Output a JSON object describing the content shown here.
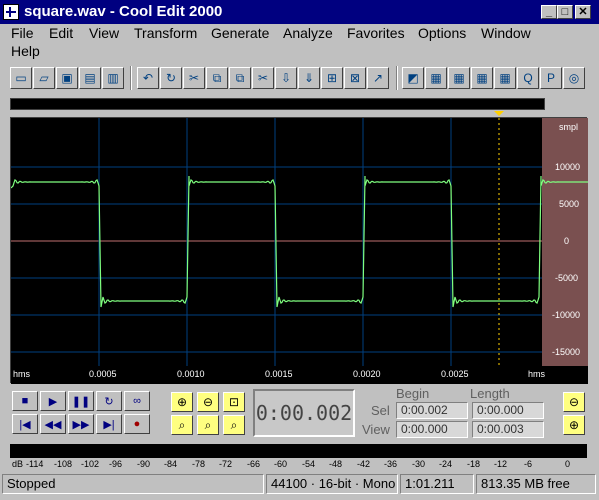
{
  "window": {
    "title": "square.wav - Cool Edit 2000",
    "minimize": "_",
    "maximize": "□",
    "close": "✕"
  },
  "menu": {
    "items": [
      "File",
      "Edit",
      "View",
      "Transform",
      "Generate",
      "Analyze",
      "Favorites",
      "Options",
      "Window",
      "Help"
    ]
  },
  "toolbar": {
    "icons": [
      "new-file-icon",
      "open-file-icon",
      "save-icon",
      "save-all-icon",
      "close-file-icon",
      "undo-icon",
      "repeat-icon",
      "mix-paste-icon",
      "copy-icon",
      "copy-to-new-icon",
      "cut-icon",
      "paste-icon",
      "paste-to-new-icon",
      "trim-icon",
      "mix-icon",
      "spectral-view-icon",
      "frequency-analysis-icon",
      "grid-icon",
      "grid-2-icon",
      "grid-3-icon",
      "cue-list-icon",
      "play-list-icon",
      "cd-icon"
    ]
  },
  "waveform": {
    "amplitude_unit": "smpl",
    "amplitude_ticks": [
      "10000",
      "5000",
      "0",
      "-5000",
      "-10000",
      "-15000"
    ],
    "time_unit_left": "hms",
    "time_unit_right": "hms",
    "time_ticks": [
      "0.0005",
      "0.0010",
      "0.0015",
      "0.0020",
      "0.0025"
    ],
    "wave_color": "#7fff7f",
    "grid_color": "#004080",
    "center_line_color": "#c07070",
    "ruler_color": "#7a5050"
  },
  "transport": {
    "stop": "■",
    "play": "▶",
    "pause": "❚❚",
    "play_looped": "↻",
    "loop": "∞",
    "goto_begin": "|◀",
    "rewind": "◀◀",
    "fast_forward": "▶▶",
    "goto_end": "▶|",
    "record": "●"
  },
  "time_display": "0:00.002",
  "selection": {
    "begin_label": "Begin",
    "length_label": "Length",
    "sel_label": "Sel",
    "view_label": "View",
    "sel_begin": "0:00.002",
    "sel_length": "0:00.000",
    "view_begin": "0:00.000",
    "view_length": "0:00.003"
  },
  "level_meter": {
    "unit": "dB",
    "ticks": [
      "-114",
      "-108",
      "-102",
      "-96",
      "-90",
      "-84",
      "-78",
      "-72",
      "-66",
      "-60",
      "-54",
      "-48",
      "-42",
      "-36",
      "-30",
      "-24",
      "-18",
      "-12",
      "-6",
      "0"
    ]
  },
  "status": {
    "state": "Stopped",
    "format": "44100 · 16-bit · Mono",
    "duration": "1:01.211",
    "free_space": "813.35 MB free"
  }
}
